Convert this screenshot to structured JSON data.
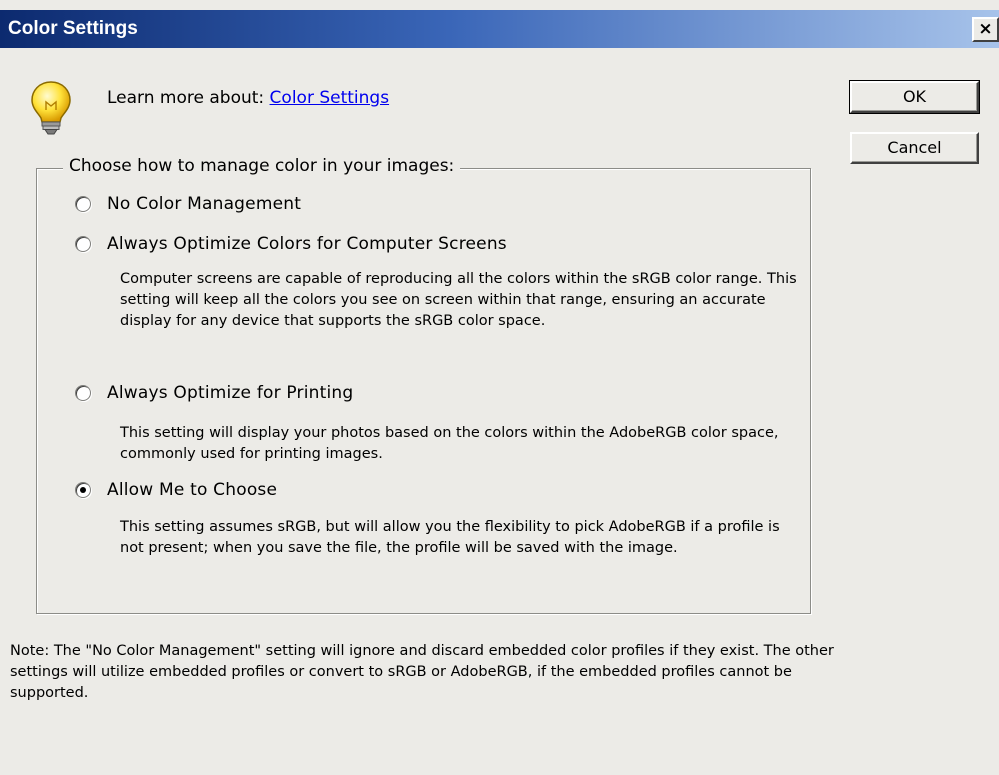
{
  "window": {
    "title": "Color Settings",
    "close_glyph": "×"
  },
  "help": {
    "prefix": "Learn more about:",
    "link": "Color Settings",
    "icon": "lightbulb-icon"
  },
  "buttons": {
    "ok": "OK",
    "cancel": "Cancel"
  },
  "group": {
    "legend": "Choose how to manage color in your images:",
    "options": [
      {
        "label": "No Color Management",
        "checked": false,
        "description": ""
      },
      {
        "label": "Always Optimize Colors for Computer Screens",
        "checked": false,
        "description": "Computer screens are capable of reproducing all the colors within the sRGB color range. This setting will keep all the colors you see on screen within that range, ensuring an accurate display for any device that supports the sRGB color space."
      },
      {
        "label": "Always Optimize for Printing",
        "checked": false,
        "description": "This setting will display your photos based on the colors within the AdobeRGB color space, commonly used for printing images."
      },
      {
        "label": "Allow Me to Choose",
        "checked": true,
        "description": "This setting assumes sRGB, but will allow you the flexibility to pick AdobeRGB if a profile is not present; when you save the file, the profile will be saved with the image."
      }
    ]
  },
  "note": "Note: The \"No Color Management\" setting will ignore and discard embedded color profiles if they exist. The other settings will utilize embedded profiles or convert to sRGB or AdobeRGB, if the embedded profiles cannot be supported.",
  "colors": {
    "titlebar_start": "#0c2a6f",
    "titlebar_end": "#a7c3ea",
    "dialog_bg": "#ecebe7",
    "link": "#0000ee"
  }
}
